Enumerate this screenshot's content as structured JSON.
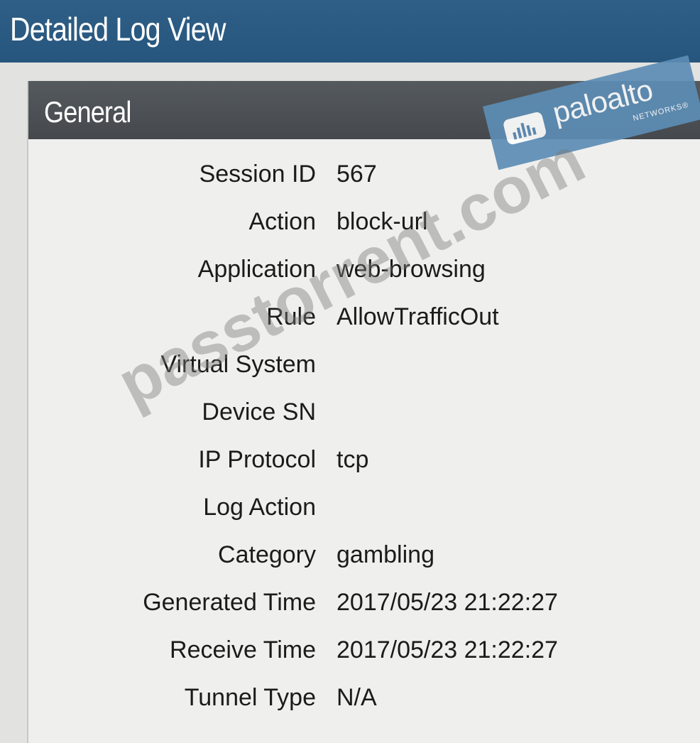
{
  "window": {
    "title": "Detailed Log View"
  },
  "panel": {
    "title": "General"
  },
  "fields": [
    {
      "label": "Session ID",
      "value": "567"
    },
    {
      "label": "Action",
      "value": "block-url"
    },
    {
      "label": "Application",
      "value": "web-browsing"
    },
    {
      "label": "Rule",
      "value": "AllowTrafficOut"
    },
    {
      "label": "Virtual System",
      "value": ""
    },
    {
      "label": "Device SN",
      "value": ""
    },
    {
      "label": "IP Protocol",
      "value": "tcp"
    },
    {
      "label": "Log Action",
      "value": ""
    },
    {
      "label": "Category",
      "value": "gambling"
    },
    {
      "label": "Generated Time",
      "value": "2017/05/23 21:22:27"
    },
    {
      "label": "Receive Time",
      "value": "2017/05/23 21:22:27"
    },
    {
      "label": "Tunnel Type",
      "value": "N/A"
    }
  ],
  "logo": {
    "name": "paloalto",
    "subtext": "NETWORKS®"
  },
  "watermark": "passtorrent.com",
  "colors": {
    "title_bar": "#2f5f86",
    "panel_header": "#4c5155",
    "logo_badge": "#5d8db5"
  }
}
